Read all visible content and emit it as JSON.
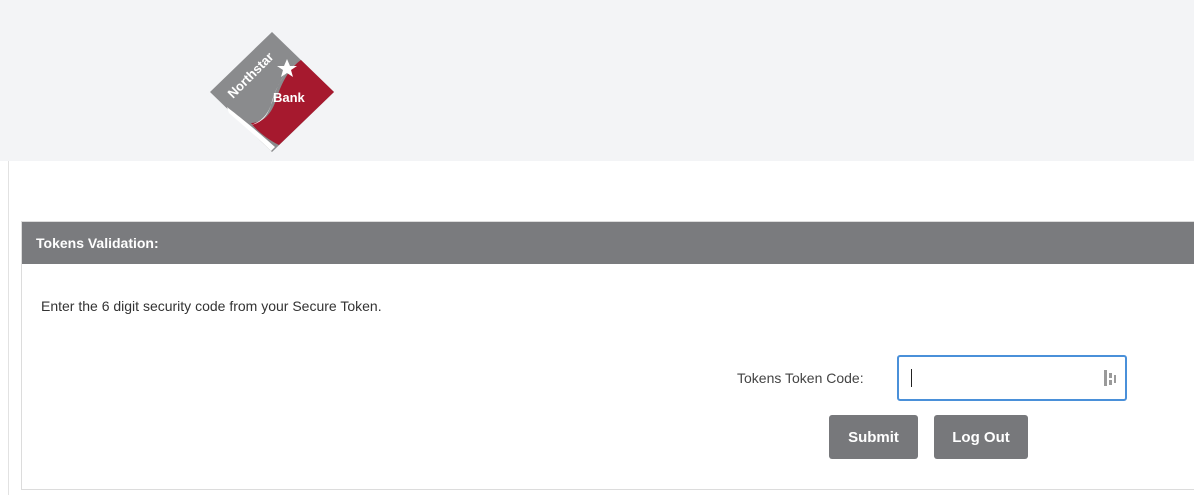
{
  "brand": {
    "logo_text_top": "Northstar",
    "logo_text_bottom": "Bank"
  },
  "panel": {
    "title": "Tokens Validation:",
    "instructions": "Enter the 6 digit security code from your Secure Token.",
    "token_label": "Tokens Token Code:",
    "token_value": ""
  },
  "actions": {
    "submit_label": "Submit",
    "logout_label": "Log Out"
  },
  "colors": {
    "header_bg": "#f3f4f6",
    "panel_header_bg": "#7a7b7e",
    "button_bg": "#77787b",
    "input_focus_border": "#4a90d9",
    "logo_gray": "#8a8b8d",
    "logo_red": "#a6192e"
  }
}
